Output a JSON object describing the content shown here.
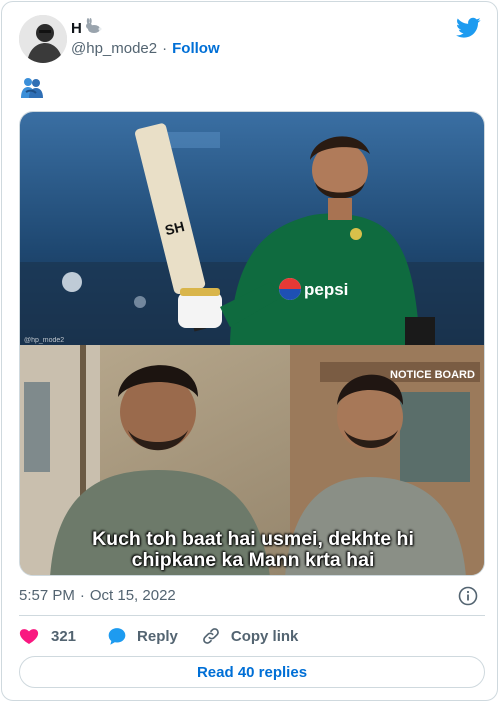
{
  "author": {
    "name": "H",
    "handle": "@hp_mode2",
    "follow_label": "Follow",
    "separator": "·",
    "name_emoji_icon": "rabbit-icon"
  },
  "tweet": {
    "text_emoji_icon": "people-hugging-icon",
    "media": {
      "top_panel_icon": "cricketer-raising-bat",
      "bat_text": "SH",
      "jersey_text": "pepsi",
      "watermark": "@hp_mode2",
      "bottom_panel_sign": "NOTICE BOARD",
      "caption_line1": "Kuch toh baat hai usmei, dekhte hi",
      "caption_line2": "chipkane ka Mann krta hai"
    },
    "time": "5:57 PM",
    "separator": "·",
    "date": "Oct 15, 2022"
  },
  "actions": {
    "like_count": "321",
    "reply_label": "Reply",
    "copy_label": "Copy link"
  },
  "read_replies_label": "Read 40 replies",
  "colors": {
    "twitter_blue": "#1d9bf0",
    "link_blue": "#006fd6",
    "like_red": "#f91880",
    "muted": "#536471",
    "border": "#cfd9de"
  }
}
